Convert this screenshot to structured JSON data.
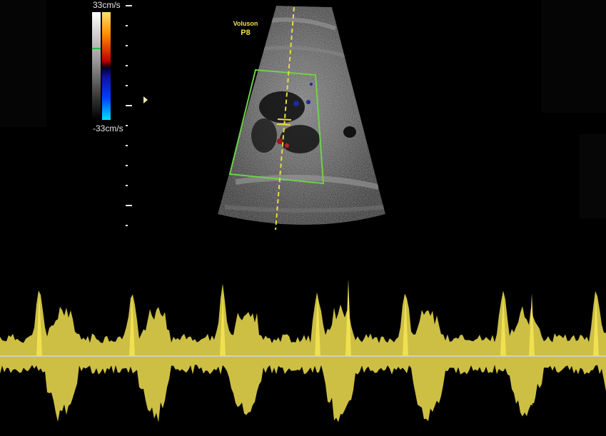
{
  "colorbar": {
    "top_label": "33cm/s",
    "bottom_label": "-33cm/s",
    "top_color": "#ff8a00",
    "bottom_color": "#00d8ff"
  },
  "brand": {
    "line1": "Voluson",
    "line2": "P8",
    "color": "#f2e34a"
  },
  "colors": {
    "background": "#000000",
    "roi_box": "#6fd24a",
    "sample_line": "#e8dc3c",
    "spectrum": "#f0e050",
    "baseline": "#c8c8c8"
  },
  "icons": {
    "depth_marker": "depth-marker-icon"
  }
}
